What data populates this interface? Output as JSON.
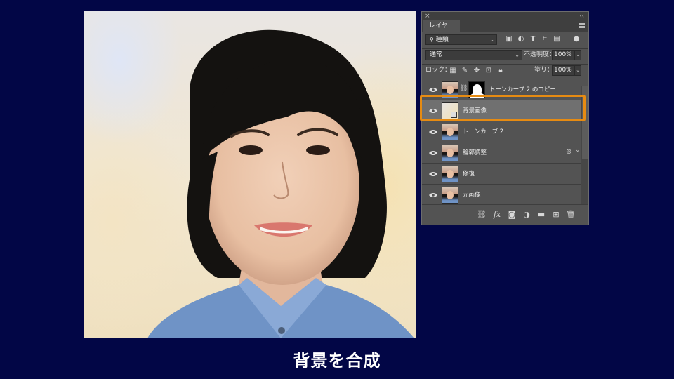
{
  "caption": "背景を合成",
  "panel": {
    "close_glyph": "×",
    "collapse_glyph": "‹‹",
    "tab_label": "レイヤー",
    "filter_kind": "種類",
    "blend_mode": "通常",
    "opacity_label": "不透明度：",
    "opacity_value": "100%",
    "lock_label": "ロック：",
    "fill_label": "塗り：",
    "fill_value": "100%"
  },
  "layers": [
    {
      "name": "トーンカーブ 2 のコピー",
      "selected": false
    },
    {
      "name": "背景画像",
      "selected": true
    },
    {
      "name": "トーンカーブ 2",
      "selected": false
    },
    {
      "name": "輪郭調整",
      "selected": false
    },
    {
      "name": "修復",
      "selected": false
    },
    {
      "name": "元画像",
      "selected": false
    }
  ],
  "footer_icons": [
    "link-icon",
    "fx-icon",
    "mask-icon",
    "adjustment-icon",
    "folder-icon",
    "new-layer-icon",
    "trash-icon"
  ],
  "colors": {
    "background": "#020646",
    "highlight": "#e68b12",
    "panel": "#535353"
  }
}
